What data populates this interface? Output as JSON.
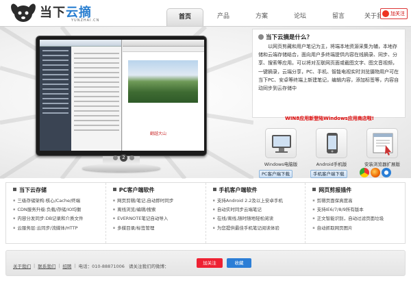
{
  "header": {
    "logo_main": "当下",
    "logo_highlight": "云摘",
    "logo_sub": "YUNZHAI.CN",
    "nav": [
      "首页",
      "产品",
      "方案",
      "论坛",
      "留言",
      "关于我们"
    ],
    "weibo_label": "加关注"
  },
  "hero": {
    "screen_caption": "翻越大山",
    "slide_current": "2"
  },
  "info": {
    "title": "当下云摘是什么？",
    "body": "以网页剪藏和用户笔记为主，将端本地资源采集为辅，本地存储和云端存储结合，面向用户多终端提供内容在线摘录、同步、分享、搜索等应用。可以将对互联网页面或截图文字、图文音视频，一键摘录，云端分享，PC、手机、智能电视实时浏览摄物用户可在当下PC、安卓等终端上新建笔记，编辑内容，添加标签等，内容自动同步到云存储中",
    "highlight": "WIN8应用新登陆Windows应用商店啦!"
  },
  "downloads": [
    {
      "label": "Windows电脑版",
      "btn": "PC客户端下载"
    },
    {
      "label": "Android手机版",
      "btn": "手机客户端下载"
    },
    {
      "label": "安装浏览器扩展版",
      "btn": ""
    }
  ],
  "features": [
    {
      "title": "当下云存储",
      "items": [
        "三级存储架构:核心/Cache/终端",
        "CDN服务升级:负载/存储/IO均衡",
        "内容分发同步:DB记录和介质文件",
        "云服务层:云同步/流媒体/HTTP"
      ]
    },
    {
      "title": "PC客户端软件",
      "items": [
        "网页剪辑/笔记,自动即时同步",
        "离线浏览/编辑/搜索",
        "EVERNOTE笔记自动导入",
        "多媒目录/标签管理"
      ]
    },
    {
      "title": "手机客户端软件",
      "items": [
        "支持Android 2.2及以上安卓手机",
        "自动实时同步云端笔记",
        "在线/离线,随时随地轻松阅读",
        "为您提供最佳手机笔记阅读体验"
      ]
    },
    {
      "title": "网页剪报插件",
      "items": [
        "剪辑页面保真度高",
        "支持IE6/7/8/9所有版本",
        "正文智能识别，自动过滤页面垃圾",
        "自动抓取网页图片"
      ]
    }
  ],
  "footer": {
    "links": [
      "关于我们",
      "联系我们",
      "招聘"
    ],
    "phone": "电话：010-88871006",
    "follow_prompt": "请关注我们的微博：",
    "follow_btn": "加关注",
    "fav_btn": "收藏"
  },
  "colors": {
    "accent_blue": "#2a7fd0",
    "alert_red": "#d00000"
  }
}
